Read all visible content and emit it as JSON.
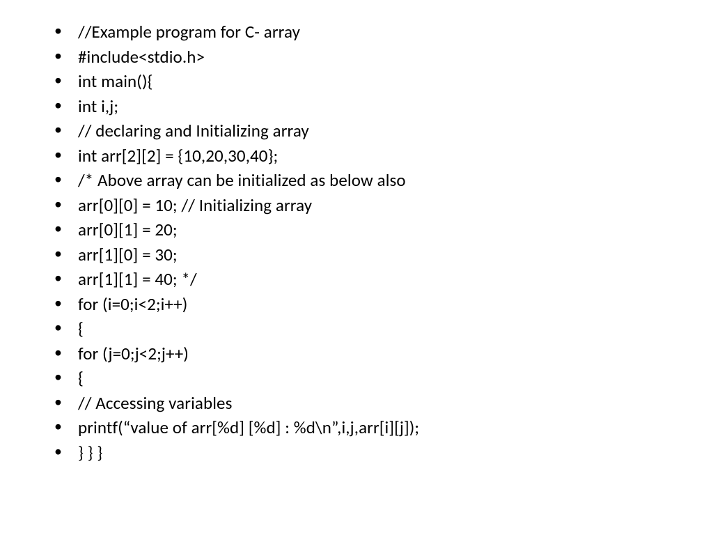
{
  "slide": {
    "lines": [
      "//Example program for C- array",
      "#include<stdio.h>",
      "int main(){",
      "int i,j;",
      "// declaring and Initializing array",
      "int arr[2][2] = {10,20,30,40};",
      "/* Above array can be initialized as below also",
      "arr[0][0] = 10; // Initializing array",
      "arr[0][1] = 20;",
      "arr[1][0] = 30;",
      "arr[1][1] = 40; */",
      "for (i=0;i<2;i++)",
      "{",
      "for (j=0;j<2;j++)",
      "{",
      "// Accessing variables",
      "printf(“value of arr[%d] [%d] : %d\\n”,i,j,arr[i][j]);",
      "}     }    }"
    ]
  }
}
